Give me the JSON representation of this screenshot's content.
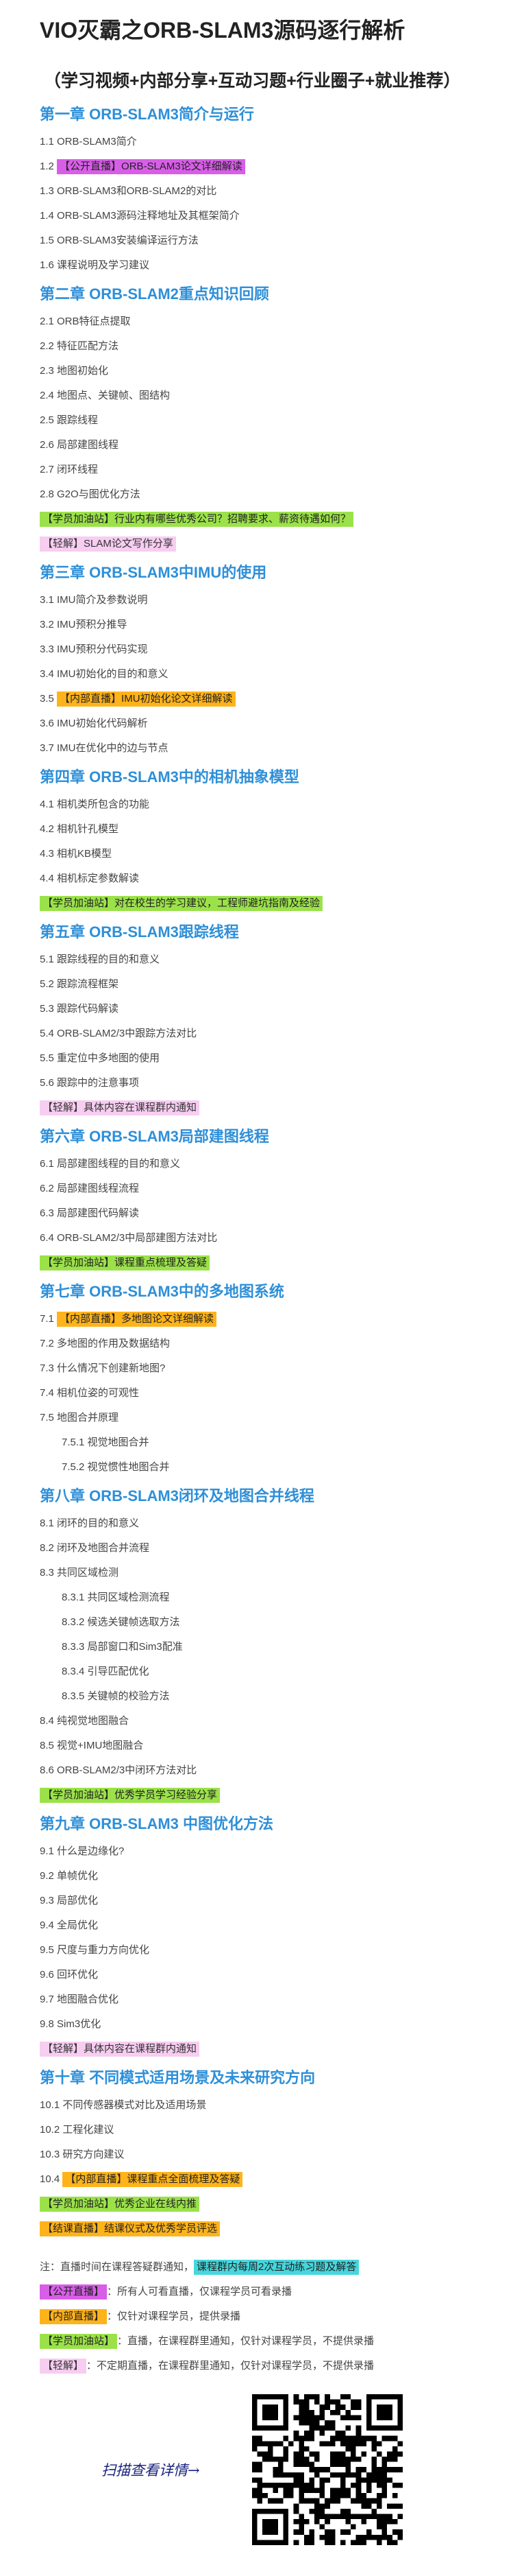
{
  "title": "VIO灭霸之ORB-SLAM3源码逐行解析",
  "subtitle": "（学习视频+内部分享+互动习题+行业圈子+就业推荐）",
  "colors": {
    "chapter": "#2e8fd8",
    "purple": "#d85ee8",
    "orange": "#ffb31a",
    "green": "#9be24a",
    "pink": "#f7cdf1",
    "cyan": "#45d7dd"
  },
  "chapters": [
    {
      "title": "第一章  ORB-SLAM3简介与运行",
      "items": [
        {
          "text": "1.1 ORB-SLAM3简介"
        },
        {
          "prefix": "1.2 ",
          "tag": "【公开直播】ORB-SLAM3论文详细解读",
          "color": "purple"
        },
        {
          "text": "1.3 ORB-SLAM3和ORB-SLAM2的对比"
        },
        {
          "text": "1.4 ORB-SLAM3源码注释地址及其框架简介"
        },
        {
          "text": "1.5 ORB-SLAM3安装编译运行方法"
        },
        {
          "text": "1.6 课程说明及学习建议"
        }
      ]
    },
    {
      "title": "第二章  ORB-SLAM2重点知识回顾",
      "items": [
        {
          "text": "2.1 ORB特征点提取"
        },
        {
          "text": "2.2 特征匹配方法"
        },
        {
          "text": "2.3 地图初始化"
        },
        {
          "text": "2.4 地图点、关键帧、图结构"
        },
        {
          "text": "2.5 跟踪线程"
        },
        {
          "text": "2.6 局部建图线程"
        },
        {
          "text": "2.7 闭环线程"
        },
        {
          "text": "2.8 G2O与图优化方法"
        },
        {
          "tag": "【学员加油站】行业内有哪些优秀公司？招聘要求、薪资待遇如何？",
          "color": "green"
        },
        {
          "tag": "【轻解】SLAM论文写作分享",
          "color": "pink"
        }
      ]
    },
    {
      "title": "第三章  ORB-SLAM3中IMU的使用",
      "items": [
        {
          "text": "3.1 IMU简介及参数说明"
        },
        {
          "text": "3.2 IMU预积分推导"
        },
        {
          "text": "3.3 IMU预积分代码实现"
        },
        {
          "text": "3.4 IMU初始化的目的和意义"
        },
        {
          "prefix": "3.5 ",
          "tag": "【内部直播】IMU初始化论文详细解读",
          "color": "orange"
        },
        {
          "text": "3.6 IMU初始化代码解析"
        },
        {
          "text": "3.7 IMU在优化中的边与节点"
        }
      ]
    },
    {
      "title": "第四章  ORB-SLAM3中的相机抽象模型",
      "items": [
        {
          "text": "4.1 相机类所包含的功能"
        },
        {
          "text": "4.2 相机针孔模型"
        },
        {
          "text": "4.3 相机KB模型"
        },
        {
          "text": "4.4 相机标定参数解读"
        },
        {
          "tag": "【学员加油站】对在校生的学习建议，工程师避坑指南及经验",
          "color": "green"
        }
      ]
    },
    {
      "title": "第五章  ORB-SLAM3跟踪线程",
      "items": [
        {
          "text": "5.1 跟踪线程的目的和意义"
        },
        {
          "text": "5.2 跟踪流程框架"
        },
        {
          "text": "5.3 跟踪代码解读"
        },
        {
          "text": "5.4 ORB-SLAM2/3中跟踪方法对比"
        },
        {
          "text": "5.5 重定位中多地图的使用"
        },
        {
          "text": "5.6 跟踪中的注意事项"
        },
        {
          "tag": "【轻解】具体内容在课程群内通知",
          "color": "pink"
        }
      ]
    },
    {
      "title": "第六章  ORB-SLAM3局部建图线程",
      "items": [
        {
          "text": "6.1 局部建图线程的目的和意义"
        },
        {
          "text": "6.2 局部建图线程流程"
        },
        {
          "text": "6.3 局部建图代码解读"
        },
        {
          "text": "6.4 ORB-SLAM2/3中局部建图方法对比"
        },
        {
          "tag": "【学员加油站】课程重点梳理及答疑",
          "color": "green"
        }
      ]
    },
    {
      "title": "第七章  ORB-SLAM3中的多地图系统",
      "items": [
        {
          "prefix": "7.1 ",
          "tag": "【内部直播】多地图论文详细解读",
          "color": "orange"
        },
        {
          "text": "7.2 多地图的作用及数据结构"
        },
        {
          "text": "7.3 什么情况下创建新地图?"
        },
        {
          "text": "7.4 相机位姿的可观性"
        },
        {
          "text": "7.5 地图合并原理"
        },
        {
          "text": "7.5.1 视觉地图合并",
          "sub": true
        },
        {
          "text": "7.5.2 视觉惯性地图合并",
          "sub": true
        }
      ]
    },
    {
      "title": "第八章  ORB-SLAM3闭环及地图合并线程",
      "items": [
        {
          "text": "8.1 闭环的目的和意义"
        },
        {
          "text": "8.2 闭环及地图合并流程"
        },
        {
          "text": "8.3 共同区域检测"
        },
        {
          "text": "8.3.1 共同区域检测流程",
          "sub": true
        },
        {
          "text": "8.3.2 候选关键帧选取方法",
          "sub": true
        },
        {
          "text": "8.3.3 局部窗口和Sim3配准",
          "sub": true
        },
        {
          "text": "8.3.4 引导匹配优化",
          "sub": true
        },
        {
          "text": "8.3.5 关键帧的校验方法",
          "sub": true
        },
        {
          "text": "8.4 纯视觉地图融合"
        },
        {
          "text": "8.5 视觉+IMU地图融合"
        },
        {
          "text": "8.6 ORB-SLAM2/3中闭环方法对比"
        },
        {
          "tag": "【学员加油站】优秀学员学习经验分享",
          "color": "green"
        }
      ]
    },
    {
      "title": "第九章  ORB-SLAM3 中图优化方法",
      "items": [
        {
          "text": "9.1 什么是边缘化?"
        },
        {
          "text": "9.2 单帧优化"
        },
        {
          "text": "9.3 局部优化"
        },
        {
          "text": "9.4 全局优化"
        },
        {
          "text": "9.5 尺度与重力方向优化"
        },
        {
          "text": "9.6 回环优化"
        },
        {
          "text": "9.7 地图融合优化"
        },
        {
          "text": "9.8 Sim3优化"
        },
        {
          "tag": "【轻解】具体内容在课程群内通知",
          "color": "pink"
        }
      ]
    },
    {
      "title": "第十章  不同模式适用场景及未来研究方向",
      "items": [
        {
          "text": "10.1 不同传感器模式对比及适用场景"
        },
        {
          "text": "10.2 工程化建议"
        },
        {
          "text": "10.3 研究方向建议"
        },
        {
          "prefix": "10.4 ",
          "tag": "【内部直播】课程重点全面梳理及答疑",
          "color": "orange"
        },
        {
          "tag": "【学员加油站】优秀企业在线内推",
          "color": "green"
        },
        {
          "tag": "【结课直播】结课仪式及优秀学员评选",
          "color": "orange"
        }
      ]
    }
  ],
  "notes": [
    {
      "text": "注：直播时间在课程答疑群通知，",
      "tag": "课程群内每周2次互动练习题及解答",
      "color": "cyan"
    },
    {
      "tag": "【公开直播】",
      "color": "purple",
      "text": "：所有人可看直播，仅课程学员可看录播"
    },
    {
      "tag": "【内部直播】",
      "color": "orange",
      "text": "：仅针对课程学员，提供录播"
    },
    {
      "tag": "【学员加油站】",
      "color": "green",
      "text": "：直播，在课程群里通知，仅针对课程学员，不提供录播"
    },
    {
      "tag": "【轻解】",
      "color": "pink",
      "text": "：不定期直播，在课程群里通知，仅针对课程学员，不提供录播"
    }
  ],
  "scan": {
    "text": "扫描查看详情→",
    "qr_icon": "qr-code-icon"
  }
}
